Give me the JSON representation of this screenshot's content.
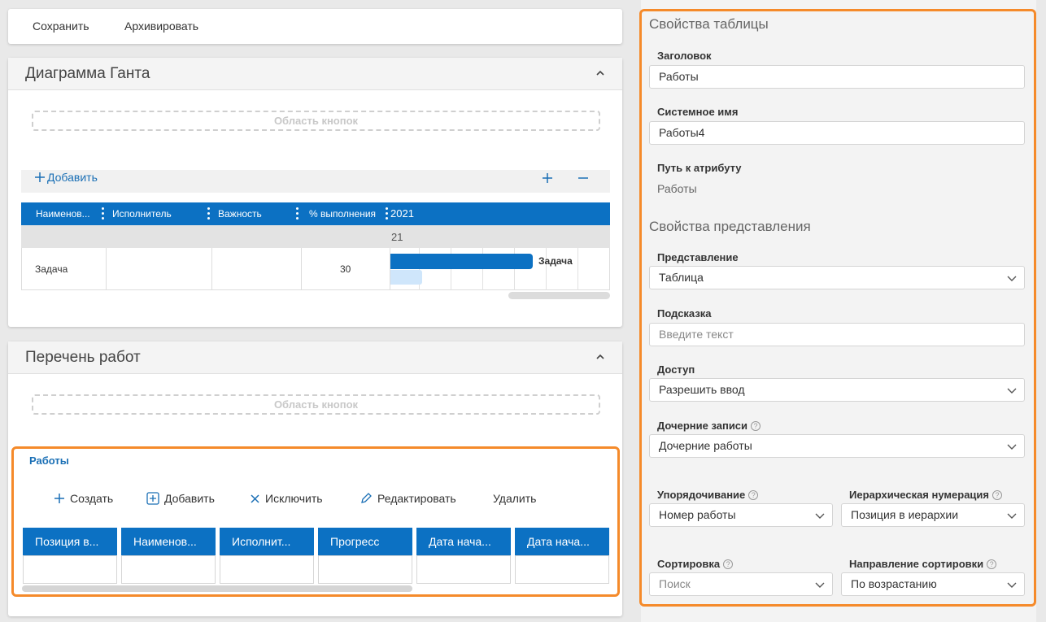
{
  "toolbar": {
    "save_label": "Сохранить",
    "archive_label": "Архивировать"
  },
  "gantt": {
    "title": "Диаграмма Ганта",
    "button_area": "Область кнопок",
    "add_label": "Добавить",
    "columns": [
      "Наименов...",
      "Исполнитель",
      "Важность",
      "% выполнения"
    ],
    "year": "2021",
    "subheader": "21",
    "row": {
      "name": "Задача",
      "executor": "",
      "importance": "",
      "percent": "30"
    },
    "bar_label": "Задача",
    "progress_fraction": 0.3
  },
  "works": {
    "title": "Перечень работ",
    "button_area": "Область кнопок",
    "table_label": "Работы",
    "actions": {
      "create": "Создать",
      "add": "Добавить",
      "exclude": "Исключить",
      "edit": "Редактировать",
      "delete": "Удалить"
    },
    "columns": [
      "Позиция в...",
      "Наименов...",
      "Исполнит...",
      "Прогресс",
      "Дата нача...",
      "Дата нача..."
    ]
  },
  "props": {
    "table_section": "Свойства таблицы",
    "heading_label": "Заголовок",
    "heading_value": "Работы",
    "sysname_label": "Системное имя",
    "sysname_value": "Работы4",
    "path_label": "Путь к атрибуту",
    "path_value": "Работы",
    "view_section": "Свойства представления",
    "view_label": "Представление",
    "view_value": "Таблица",
    "hint_label": "Подсказка",
    "hint_placeholder": "Введите текст",
    "access_label": "Доступ",
    "access_value": "Разрешить ввод",
    "child_label": "Дочерние записи",
    "child_value": "Дочерние работы",
    "order_label": "Упорядочивание",
    "order_value": "Номер работы",
    "numbering_label": "Иерархическая нумерация",
    "numbering_value": "Позиция в иерархии",
    "sort_label": "Сортировка",
    "sort_placeholder": "Поиск",
    "sortdir_label": "Направление сортировки",
    "sortdir_value": "По возрастанию"
  },
  "colors": {
    "accent": "#0c71c3",
    "highlight": "#f58a2a",
    "link": "#1a6fb5"
  }
}
